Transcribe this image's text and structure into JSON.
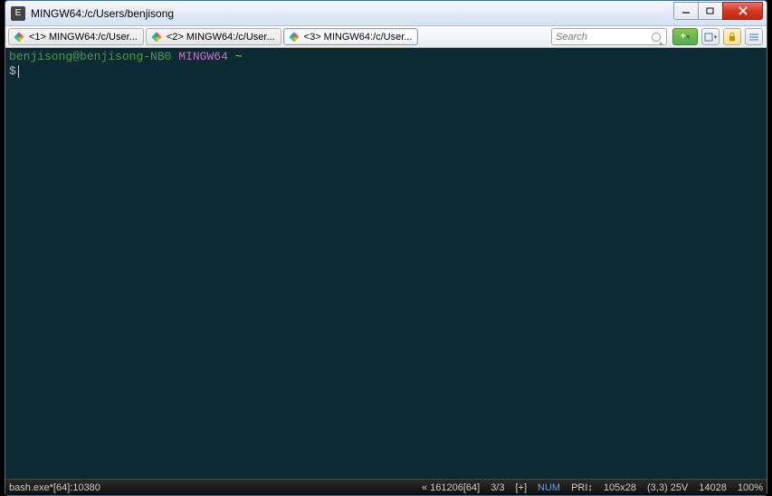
{
  "title": "MINGW64:/c/Users/benjisong",
  "tabs": [
    {
      "label": "<1> MINGW64:/c/User...",
      "active": false
    },
    {
      "label": "<2> MINGW64:/c/User...",
      "active": false
    },
    {
      "label": "<3> MINGW64:/c/User...",
      "active": true
    }
  ],
  "search": {
    "placeholder": "Search"
  },
  "terminal": {
    "user": "benjisong",
    "host": "benjisong-NB0",
    "env": "MINGW64",
    "path": "~",
    "prompt": "$"
  },
  "status": {
    "process": "bash.exe*[64]:10380",
    "session": "« 161206[64]",
    "consoles": "3/3",
    "add": "[+]",
    "num": "NUM",
    "pri": "PRI↕",
    "size": "105x28",
    "cursor": "(3,3) 25V",
    "pid": "14028",
    "zoom": "100%"
  }
}
